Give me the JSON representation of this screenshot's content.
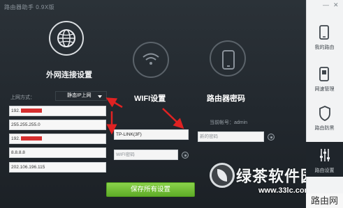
{
  "app": {
    "title": "路由器助手 0.9X版"
  },
  "wan": {
    "title": "外网连接设置",
    "mode_label": "上网方式：",
    "mode_value": "静态IP上网",
    "fields": [
      "192.",
      "255.255.255.0",
      "192.",
      "8.8.8.8",
      "202.106.196.115"
    ]
  },
  "wifi": {
    "title": "WIFI设置",
    "ssid_value": "TP-LINK(3F)",
    "password_placeholder": "WIFI密码"
  },
  "router_password": {
    "title": "路由器密码",
    "account_label": "当前帐号：admin",
    "password_placeholder": "新的密码"
  },
  "save_label": "保存所有设置",
  "sidebar": {
    "items": [
      {
        "label": "我的路由",
        "icon": "phone-icon"
      },
      {
        "label": "网速管理",
        "icon": "speed-manage-icon"
      },
      {
        "label": "路由防黑",
        "icon": "shield-icon"
      },
      {
        "label": "路由设置",
        "icon": "settings-sliders-icon"
      }
    ]
  },
  "watermark": {
    "brand": "绿茶软件园",
    "url": "www.33lc.com",
    "corner_text": "路由网"
  }
}
